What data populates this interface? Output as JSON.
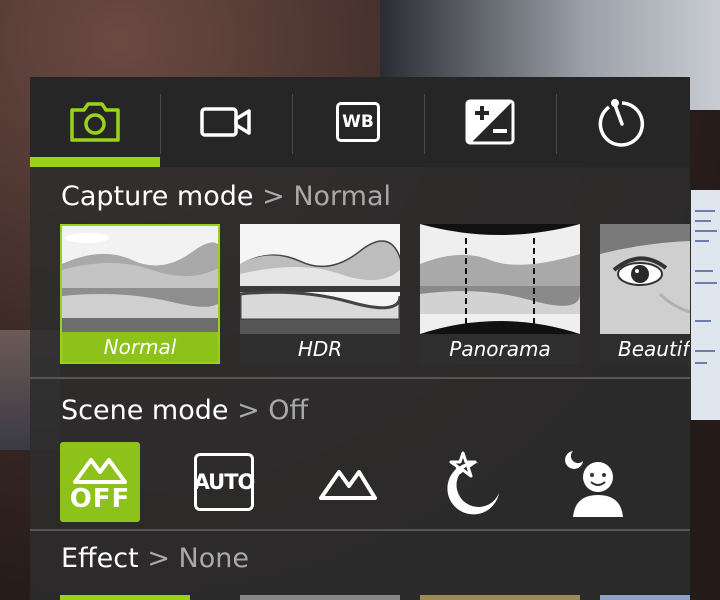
{
  "tabs": [
    {
      "name": "camera-icon"
    },
    {
      "name": "video-icon"
    },
    {
      "name": "white-balance-icon",
      "label": "WB"
    },
    {
      "name": "exposure-icon"
    },
    {
      "name": "timer-icon"
    }
  ],
  "capture": {
    "title": "Capture mode",
    "separator": ">",
    "value": "Normal",
    "modes": [
      "Normal",
      "HDR",
      "Panorama",
      "Beautific"
    ]
  },
  "scene": {
    "title": "Scene mode",
    "separator": ">",
    "value": "Off",
    "off_label": "OFF",
    "auto_label": "AUTO",
    "icons": [
      "scene-off-icon",
      "scene-auto-icon",
      "landscape-icon",
      "night-icon",
      "portrait-icon"
    ]
  },
  "effect": {
    "title": "Effect",
    "separator": ">",
    "value": "None"
  },
  "colors": {
    "accent": "#9ad21b",
    "panel": "#2c2c2c",
    "text": "#ffffff",
    "muted": "#a9a9a9"
  }
}
